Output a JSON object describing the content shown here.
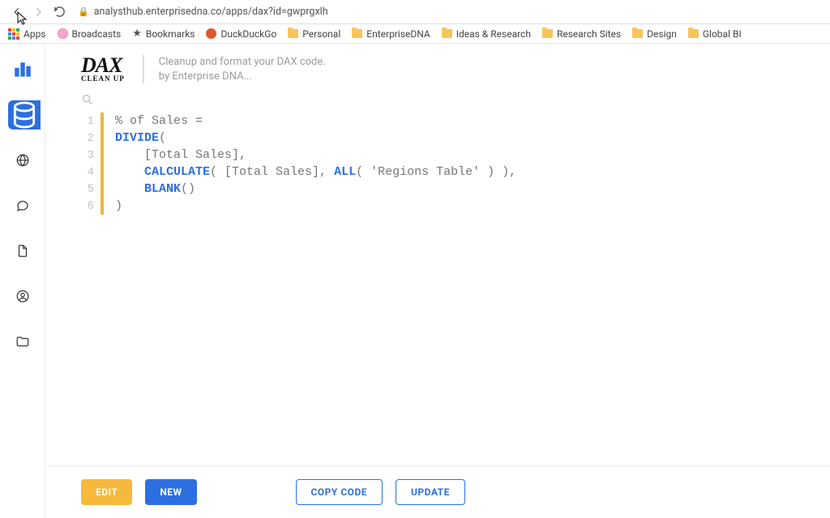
{
  "browser": {
    "url": "analysthub.enterprisedna.co/apps/dax?id=gwprgxlh",
    "bookmarks": [
      {
        "label": "Apps",
        "icon": "apps"
      },
      {
        "label": "Broadcasts",
        "icon": "pink"
      },
      {
        "label": "Bookmarks",
        "icon": "star"
      },
      {
        "label": "DuckDuckGo",
        "icon": "duck"
      },
      {
        "label": "Personal",
        "icon": "folder"
      },
      {
        "label": "EnterpriseDNA",
        "icon": "folder"
      },
      {
        "label": "Ideas & Research",
        "icon": "folder"
      },
      {
        "label": "Research Sites",
        "icon": "folder"
      },
      {
        "label": "Design",
        "icon": "folder"
      },
      {
        "label": "Global BI",
        "icon": "folder"
      }
    ]
  },
  "header": {
    "brand_top": "DAX",
    "brand_bottom": "CLEAN UP",
    "tagline_1": "Cleanup and format your DAX code.",
    "tagline_2": "by Enterprise DNA..."
  },
  "code": {
    "lines": [
      {
        "n": "1",
        "segs": [
          {
            "t": "% of Sales ",
            "c": "txt"
          },
          {
            "t": "=",
            "c": "eq"
          }
        ]
      },
      {
        "n": "2",
        "segs": [
          {
            "t": "DIVIDE",
            "c": "kw"
          },
          {
            "t": "(",
            "c": "txt"
          }
        ]
      },
      {
        "n": "3",
        "segs": [
          {
            "t": "    [Total Sales],",
            "c": "txt"
          }
        ]
      },
      {
        "n": "4",
        "segs": [
          {
            "t": "    ",
            "c": "txt"
          },
          {
            "t": "CALCULATE",
            "c": "kw"
          },
          {
            "t": "( [Total Sales], ",
            "c": "txt"
          },
          {
            "t": "ALL",
            "c": "kw"
          },
          {
            "t": "( ",
            "c": "txt"
          },
          {
            "t": "'Regions Table'",
            "c": "str"
          },
          {
            "t": " ) ),",
            "c": "txt"
          }
        ]
      },
      {
        "n": "5",
        "segs": [
          {
            "t": "    ",
            "c": "txt"
          },
          {
            "t": "BLANK",
            "c": "kw"
          },
          {
            "t": "()",
            "c": "txt"
          }
        ]
      },
      {
        "n": "6",
        "segs": [
          {
            "t": ")",
            "c": "txt"
          }
        ]
      }
    ]
  },
  "footer": {
    "edit": "EDIT",
    "new": "NEW",
    "copy": "COPY CODE",
    "update": "UPDATE"
  }
}
